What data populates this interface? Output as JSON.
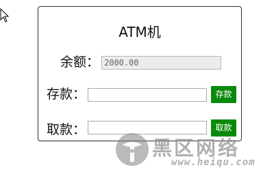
{
  "atm": {
    "title": "ATM机",
    "balance_label": "余额：",
    "balance_value": "2000.00",
    "deposit_label": "存款：",
    "deposit_value": "",
    "deposit_button": "存款",
    "withdraw_label": "取款：",
    "withdraw_value": "",
    "withdraw_button": "取款"
  },
  "watermark": {
    "name": "黑区网络",
    "url": "www.heiqu.com"
  },
  "colors": {
    "button_bg": "#0a8a0a",
    "button_text": "#ffffff",
    "panel_border": "#2b2b2b",
    "readonly_field_bg": "#ececec"
  },
  "icons": {
    "cursor": "mouse-pointer-icon",
    "watermark_logo": "heiqu-logo-icon"
  }
}
